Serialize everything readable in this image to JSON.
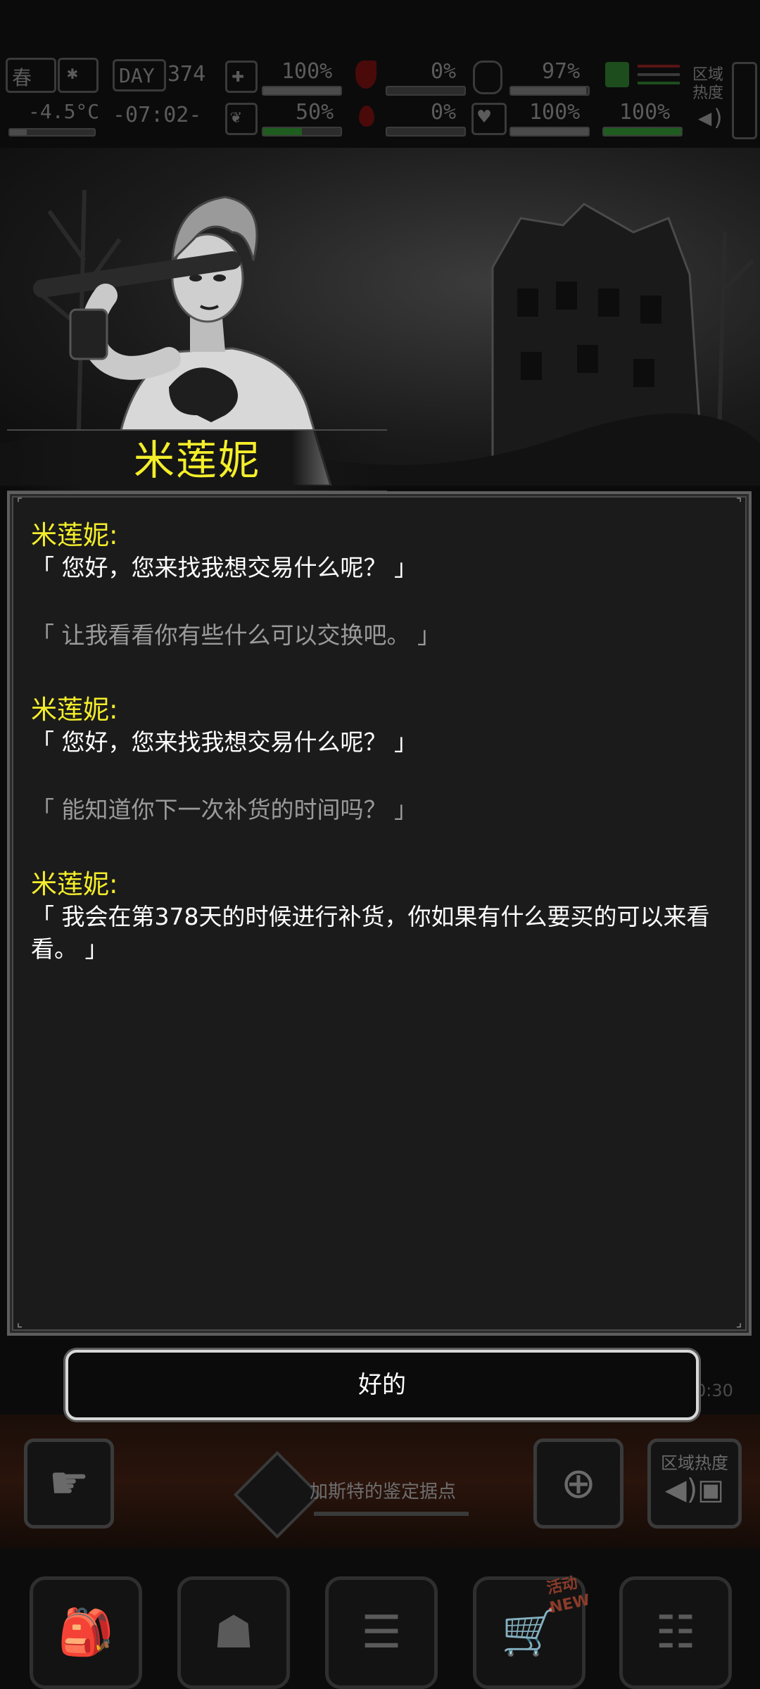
{
  "hud": {
    "season": "春",
    "snow_icon": "snow-icon",
    "day_label": "DAY",
    "day_number": "374",
    "temperature": "-4.5°C",
    "time": "-07:02-",
    "stats": [
      {
        "icon": "medkit-icon",
        "value": "100%",
        "level": 1.0
      },
      {
        "icon": "stomach-icon",
        "value": "0%",
        "level": 0.0
      },
      {
        "icon": "canteen-icon",
        "value": "97%",
        "level": 0.97
      },
      {
        "icon": "brain-icon",
        "value": "50%",
        "level": 0.5
      },
      {
        "icon": "blood-drop-icon",
        "value": "0%",
        "level": 0.0
      },
      {
        "icon": "heart-icon",
        "value": "100%",
        "level": 1.0
      },
      {
        "icon": "stamina-icon",
        "value": "100%",
        "level": 1.0
      }
    ],
    "region_heat_label": "区域\n热度"
  },
  "npc": {
    "name": "米莲妮"
  },
  "dialog": {
    "messages": [
      {
        "speaker": "米莲妮:",
        "text": "「 您好，您来找我想交易什么呢？ 」"
      },
      {
        "player": "「 让我看看你有些什么可以交换吧。 」"
      },
      {
        "speaker": "米莲妮:",
        "text": "「 您好，您来找我想交易什么呢？ 」"
      },
      {
        "player": "「 能知道你下一次补货的时间吗？ 」"
      },
      {
        "speaker": "米莲妮:",
        "text": "「 我会在第378天的时候进行补货，你如果有什么要买的可以来看看。 」"
      }
    ]
  },
  "ok_button": "好的",
  "background_hud": {
    "timer_fragment": "0:30",
    "camp_label": "加斯特的鉴定据点",
    "region_heat_label": "区域热度"
  },
  "bottom_nav": {
    "items": [
      {
        "icon": "backpack-icon"
      },
      {
        "icon": "brain-head-icon"
      },
      {
        "icon": "journal-icon"
      },
      {
        "icon": "shopping-cart-icon",
        "badge_top": "活动",
        "badge_bottom": "NEW"
      },
      {
        "icon": "menu-list-icon"
      }
    ]
  }
}
